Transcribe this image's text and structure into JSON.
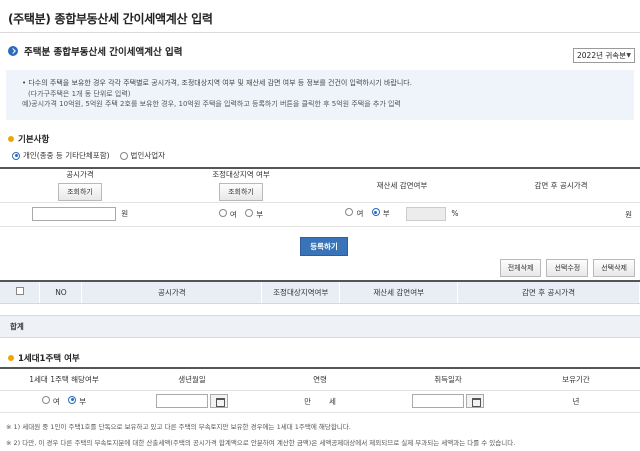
{
  "page": {
    "title": "(주택분) 종합부동산세 간이세액계산 입력"
  },
  "section": {
    "heading": "주택분 종합부동산세 간이세액계산 입력",
    "year_select": "2022년 귀속분"
  },
  "notice": {
    "lines": [
      "다수의 주택을 보유한 경우 각각 주택별로 공시가격, 조정대상지역 여부 및 재산세 감면 여부 등 정보를 건건이 입력하시기 바랍니다.",
      "(다가구주택은 1개 동 단위로 입력)",
      "예)공시가격 10억원, 5억원 주택 2호를 보유한 경우, 10억원 주택을 입력하고 등록하기 버튼을 클릭한 후 5억원 주택을 추가 입력"
    ]
  },
  "basic": {
    "heading": "기본사항",
    "options": [
      "개인(종중 등 기타단체포함)",
      "법인사업자"
    ],
    "selected": 0,
    "col_price": "공시가격",
    "col_adjust": "조정대상지역 여부",
    "col_reduce": "재산세 감면여부",
    "col_after": "감면 후 공시가격",
    "lookup_btn": "조회하기",
    "unit_won": "원",
    "unit_pct": "%",
    "yes": "여",
    "no": "부"
  },
  "register_btn": "등록하기",
  "actions": {
    "delete_all": "전체삭제",
    "edit_selected": "선택수정",
    "delete_selected": "선택삭제"
  },
  "list": {
    "headers": [
      "NO",
      "공시가격",
      "조정대상지역여부",
      "재산세 감면여부",
      "감면 후 공시가격"
    ],
    "sum_label": "합계"
  },
  "household": {
    "heading": "1세대1주택 여부",
    "headers": [
      "1세대 1주택 해당여부",
      "생년월일",
      "연령",
      "취득일자",
      "보유기간"
    ],
    "yes": "여",
    "no": "부",
    "age_unit": "만",
    "age_suffix": "세",
    "period_unit": "년"
  },
  "footnotes": [
    "※ 1) 세대원 중 1인이 주택1호를 단독으로 보유하고 있고 다른 주택의 부속토지만 보유한 경우에는 1세대 1주택에 해당합니다.",
    "※ 2) 다만, 이 경우 다른 주택의 부속토지분에 대한 산출세액(주택의 공시가격 합계액으로 안분하여 계산한 금액)은 세액공제대상에서 제외되므로 실제 부과되는 세액과는 다를 수 있습니다."
  ],
  "colors": {
    "accent": "#2a6bbd",
    "orange": "#f0a500",
    "notice_bg": "#eef4fa"
  }
}
